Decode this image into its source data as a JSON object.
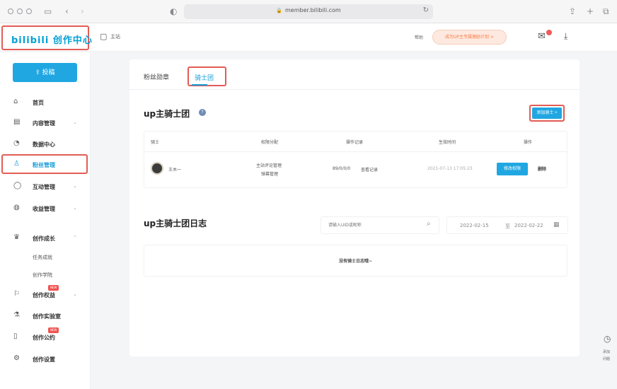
{
  "browser": {
    "url": "member.bilibili.com"
  },
  "header": {
    "logo": "bilibili 创作中心",
    "home_label": "主站",
    "small_link": "帮助",
    "promo": "成为UP主专属激励计划 >"
  },
  "sidebar": {
    "upload_label": "投稿",
    "items": [
      {
        "label": "首页"
      },
      {
        "label": "内容管理"
      },
      {
        "label": "数据中心"
      },
      {
        "label": "粉丝管理"
      },
      {
        "label": "互动管理"
      },
      {
        "label": "收益管理"
      },
      {
        "label": "创作成长"
      },
      {
        "label": "创作权益"
      },
      {
        "label": "创作实验室"
      },
      {
        "label": "创作公约"
      },
      {
        "label": "创作设置"
      }
    ],
    "sub_items": [
      "任务成就",
      "创作学院"
    ],
    "badge_text": "NEW"
  },
  "main": {
    "tabs": [
      {
        "label": "粉丝勋章"
      },
      {
        "label": "骑士团"
      }
    ],
    "section_title": "up主骑士团",
    "add_button": "添加骑士",
    "table": {
      "columns": [
        "骑士",
        "权限分配",
        "操作记录",
        "生效时间",
        "操作"
      ],
      "row": {
        "name": "王木一",
        "permission_1": "主站评论管理",
        "permission_2": "弹幕管理",
        "record": "89/0/0/0",
        "record_link": "查看记录",
        "time": "2021-07-13 17:05:23",
        "edit": "修改权限",
        "delete": "删除"
      }
    },
    "log_title": "up主骑士团日志",
    "search_placeholder": "请输入UID或昵称",
    "date_start": "2022-02-15",
    "date_sep": "至",
    "date_end": "2022-02-22",
    "empty": "没有骑士日志哦~"
  },
  "float": {
    "line1": "添加",
    "line2": "问题"
  },
  "colors": {
    "accent": "#20a7e2",
    "highlight_border": "#e25c55"
  }
}
